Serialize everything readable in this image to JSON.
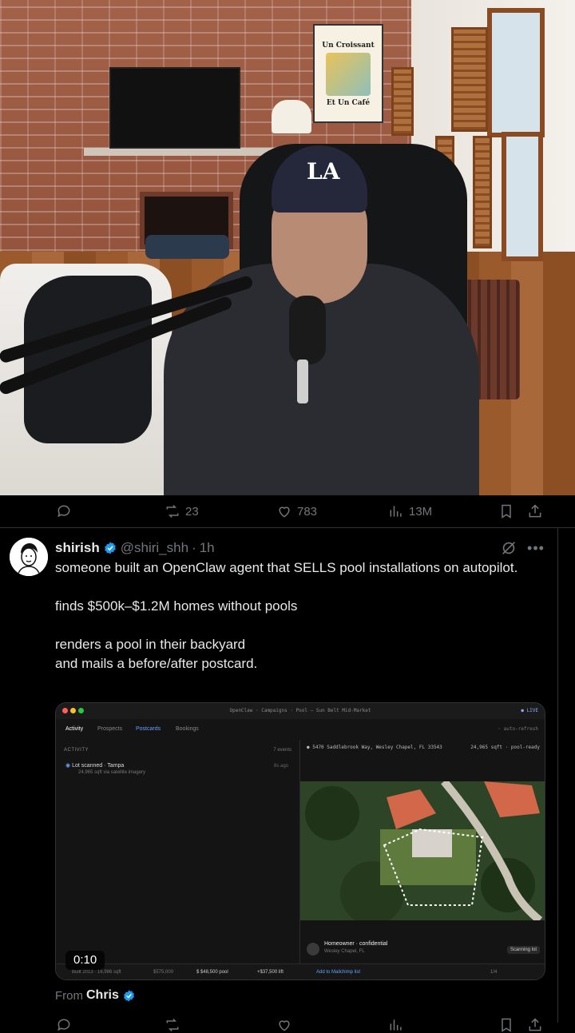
{
  "poster": {
    "line1": "Un Croissant",
    "line2": "Et Un Café"
  },
  "cap_logo": "LA",
  "video_actions": {
    "reposts": "23",
    "likes": "783",
    "views": "13M"
  },
  "tweet": {
    "name": "shirish",
    "handle": "@shiri_shh",
    "separator": "·",
    "time": "1h",
    "body": {
      "line1": "someone built an OpenClaw agent that SELLS pool installations on autopilot.",
      "line2": "finds $500k–$1.2M homes without pools",
      "line3": "renders a pool in their backyard",
      "line4": "and mails a before/after postcard."
    },
    "from_prefix": "From",
    "from_name": "Chris"
  },
  "media": {
    "title": "OpenClaw · Campaigns · Pool — Sun Belt Mid-Market",
    "live": "● LIVE",
    "tabs": [
      "Activity",
      "Prospects",
      "Postcards",
      "Bookings"
    ],
    "autorefresh": "◦ auto-refresh",
    "activity_label": "ACTIVITY",
    "events": "7 events",
    "item_title": "Lot scanned · Tampa",
    "item_sub": "24,965 sqft via satellite imagery",
    "item_time": "8s ago",
    "address": "● 5470 Saddlebrook Way, Wesley Chapel, FL 33543",
    "sqft": "24,965 sqft · pool-ready",
    "homeowner": "Homeowner · confidential",
    "homeowner_sub": "Wesley Chapel, FL",
    "homeowner_initials": "CS",
    "scanning": "Scanning lot",
    "footer": [
      "Built 2013 · 16,986 sqft",
      "$575,000",
      "$ $48,500 pool",
      "+$37,500 lift",
      "Add to Mailchimp list",
      "1/4"
    ],
    "timestamp": "0:10"
  },
  "colors": {
    "verified": "#1d9bf0",
    "muted": "#71767b",
    "text": "#e7e9ea"
  },
  "icons": {
    "reply": "reply-icon",
    "repost": "repost-icon",
    "like": "heart-icon",
    "views": "views-icon",
    "bookmark": "bookmark-icon",
    "share": "share-icon",
    "verified": "verified-badge-icon",
    "grok": "grok-icon",
    "more": "more-icon"
  }
}
